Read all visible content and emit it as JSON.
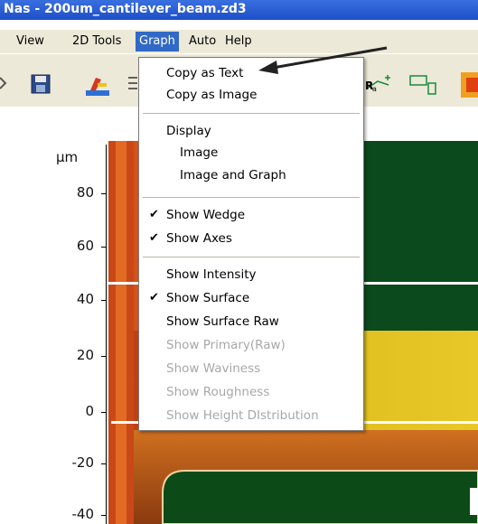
{
  "window": {
    "title": "Nas - 200um_cantilever_beam.zd3"
  },
  "menubar": {
    "items": [
      {
        "label": "View"
      },
      {
        "label": "2D Tools"
      },
      {
        "label": "Graph"
      },
      {
        "label": "Auto"
      },
      {
        "label": "Help"
      }
    ]
  },
  "toolbar": {
    "icons": [
      "partial-icon",
      "save-icon",
      "microscope-icon",
      "layers-icon",
      "roughness-ra-icon",
      "window-icon",
      "color-icon"
    ],
    "ra_label": "R",
    "ra_subscript": "a"
  },
  "graph_menu": {
    "items": [
      {
        "label": "Copy as Text",
        "checked": false,
        "disabled": false
      },
      {
        "label": "Copy as Image",
        "checked": false,
        "disabled": false
      },
      {
        "label": "Display",
        "checked": false,
        "disabled": false
      },
      {
        "label": "Image",
        "checked": false,
        "disabled": false
      },
      {
        "label": "Image and Graph",
        "checked": false,
        "disabled": false
      },
      {
        "label": "Show Wedge",
        "checked": true,
        "disabled": false
      },
      {
        "label": "Show Axes",
        "checked": true,
        "disabled": false
      },
      {
        "label": "Show Intensity",
        "checked": false,
        "disabled": false
      },
      {
        "label": "Show Surface",
        "checked": true,
        "disabled": false
      },
      {
        "label": "Show Surface Raw",
        "checked": false,
        "disabled": false
      },
      {
        "label": "Show Primary(Raw)",
        "checked": false,
        "disabled": true
      },
      {
        "label": "Show Waviness",
        "checked": false,
        "disabled": true
      },
      {
        "label": "Show Roughness",
        "checked": false,
        "disabled": true
      },
      {
        "label": "Show Height DIstribution",
        "checked": false,
        "disabled": true
      }
    ],
    "check_glyph": "✔"
  },
  "plot": {
    "unit": "µm",
    "y_ticks": [
      "80",
      "60",
      "40",
      "20",
      "0",
      "-20",
      "-40"
    ]
  },
  "colors": {
    "menu_highlight": "#316ac5",
    "disabled_text": "#a8a8a8",
    "titlebar": "#1d4fc8"
  }
}
